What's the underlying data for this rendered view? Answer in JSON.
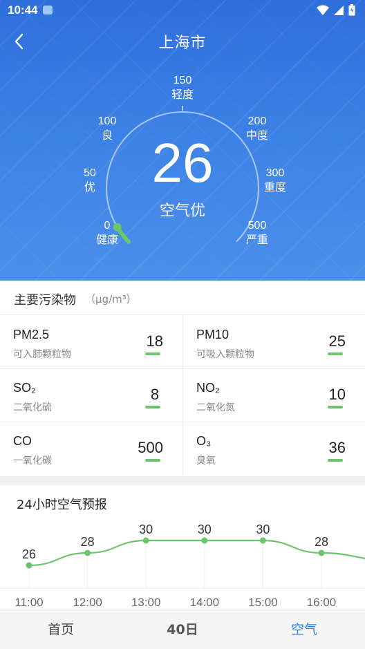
{
  "status_bar": {
    "time": "10:44"
  },
  "header": {
    "city": "上海市"
  },
  "gauge": {
    "aqi": "26",
    "level": "空气优",
    "fill_fraction": 0.052,
    "ticks": [
      {
        "value": "0",
        "label": "健康"
      },
      {
        "value": "50",
        "label": "优"
      },
      {
        "value": "100",
        "label": "良"
      },
      {
        "value": "150",
        "label": "轻度"
      },
      {
        "value": "200",
        "label": "中度"
      },
      {
        "value": "300",
        "label": "重度"
      },
      {
        "value": "500",
        "label": "严重"
      }
    ]
  },
  "pollutants": {
    "title": "主要污染物",
    "unit": "（μg/m³）",
    "items": [
      {
        "name": "PM2.5",
        "desc": "可入肺颗粒物",
        "value": "18"
      },
      {
        "name": "PM10",
        "desc": "可吸入颗粒物",
        "value": "25"
      },
      {
        "name": "SO₂",
        "desc": "二氧化硫",
        "value": "8"
      },
      {
        "name": "NO₂",
        "desc": "二氧化氮",
        "value": "10"
      },
      {
        "name": "CO",
        "desc": "一氧化碳",
        "value": "500"
      },
      {
        "name": "O₃",
        "desc": "臭氧",
        "value": "36"
      }
    ]
  },
  "forecast": {
    "title": "24小时空气预报",
    "hours": [
      "11:00",
      "12:00",
      "13:00",
      "14:00",
      "15:00",
      "16:00"
    ],
    "values": [
      26,
      28,
      30,
      30,
      30,
      28
    ]
  },
  "colors": {
    "good": "#6cc56e",
    "accent": "#2f7ff0",
    "hero": "#3d82e6"
  },
  "nav": {
    "home": "首页",
    "forty_day": "40日",
    "air": "空气"
  }
}
